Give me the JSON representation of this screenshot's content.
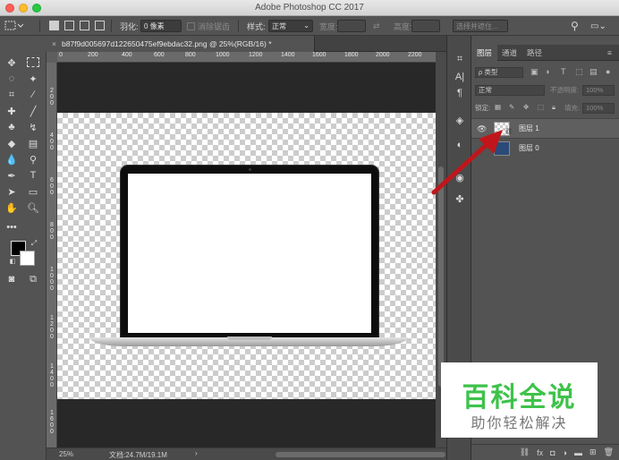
{
  "window": {
    "title": "Adobe Photoshop CC 2017"
  },
  "options_bar": {
    "feather_label": "羽化:",
    "feather_value": "0 像素",
    "antialias_label": "消除锯齿",
    "style_label": "样式:",
    "style_value": "正常",
    "width_label": "宽度:",
    "height_label": "高度:",
    "select_mask_button": "选择并遮住..."
  },
  "document": {
    "tab_title": "b87f9d005697d122650475ef9ebdac32.png @ 25%(RGB/16) *",
    "close_glyph": "×"
  },
  "ruler": {
    "top_labels": [
      "0",
      "200",
      "400",
      "600",
      "800",
      "1000",
      "1200",
      "1400",
      "1600",
      "1800",
      "2000",
      "2200"
    ],
    "left_labels": [
      "2\n0\n0",
      "4\n0\n0",
      "6\n0\n0",
      "8\n0\n0",
      "1\n0\n0\n0",
      "1\n2\n0\n0",
      "1\n4\n0\n0",
      "1\n6\n0\n0"
    ]
  },
  "status_bar": {
    "zoom": "25%",
    "doc_info": "文档:24.7M/19.1M"
  },
  "layers_panel": {
    "tabs": [
      "图层",
      "通道",
      "路径"
    ],
    "active_tab": "图层",
    "filter_label": "ρ 类型",
    "blend_mode": "正常",
    "opacity_label": "不透明度:",
    "opacity_value": "100%",
    "lock_label": "锁定:",
    "fill_label": "填充:",
    "fill_value": "100%",
    "layers": [
      {
        "name": "图层 1",
        "visible": true,
        "selected": true
      },
      {
        "name": "图层 0",
        "visible": false,
        "selected": false
      }
    ],
    "bottom_icons": [
      "link-icon",
      "fx-icon",
      "mask-icon",
      "adjustment-icon",
      "folder-icon",
      "new-layer-icon",
      "trash-icon"
    ]
  },
  "watermark": {
    "main": "百科全说",
    "sub": "助你轻松解决",
    "main_color": "#3ec24a"
  },
  "annotation": {
    "arrow_color": "#c0161b"
  }
}
